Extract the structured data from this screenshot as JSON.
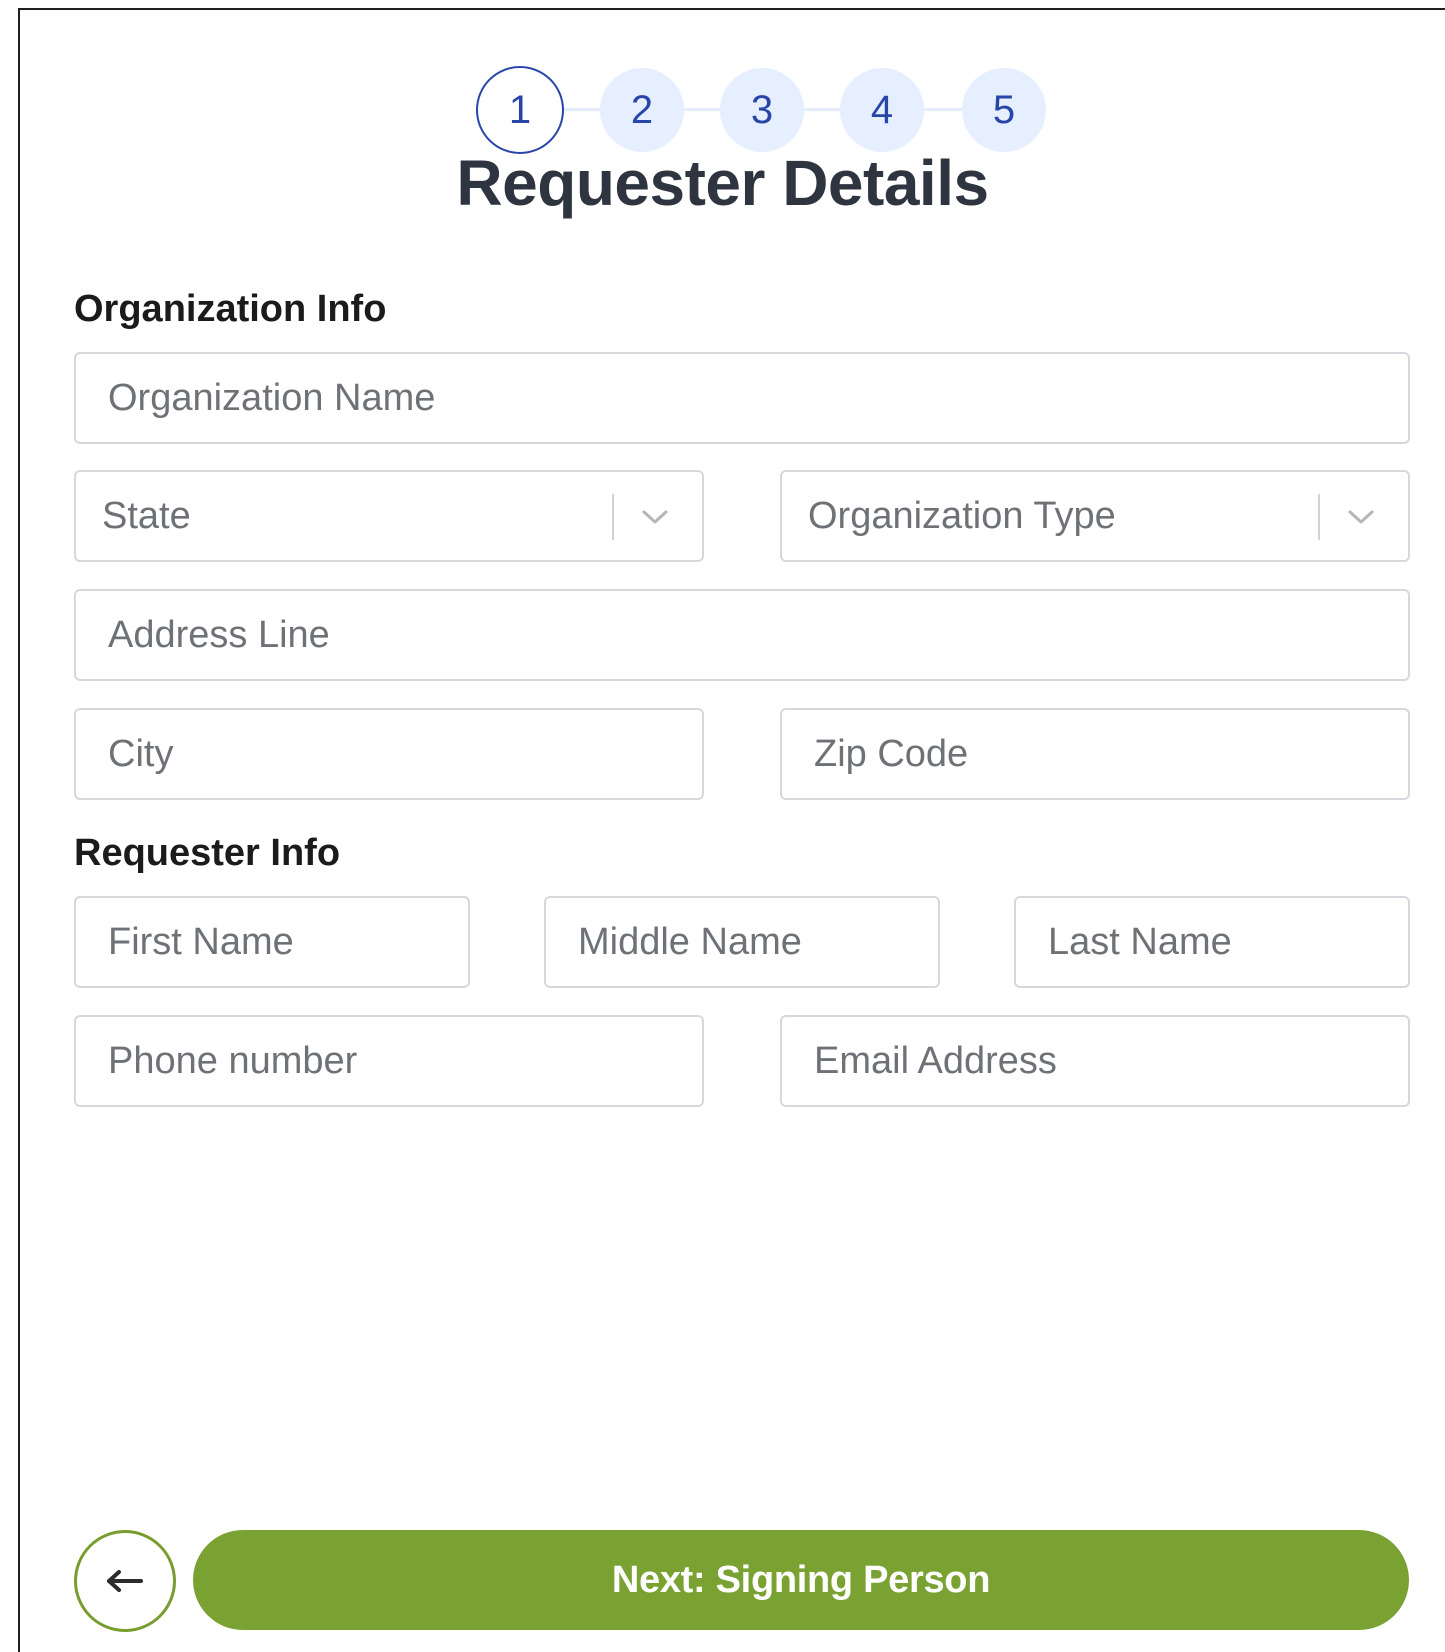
{
  "stepper": {
    "steps": [
      "1",
      "2",
      "3",
      "4",
      "5"
    ],
    "active_step": 1
  },
  "page_title": "Requester Details",
  "organization": {
    "section_title": "Organization Info",
    "name_placeholder": "Organization Name",
    "state_placeholder": "State",
    "type_placeholder": "Organization Type",
    "address_placeholder": "Address Line",
    "city_placeholder": "City",
    "zip_placeholder": "Zip Code"
  },
  "requester": {
    "section_title": "Requester Info",
    "first_name_placeholder": "First Name",
    "middle_name_placeholder": "Middle Name",
    "last_name_placeholder": "Last Name",
    "phone_placeholder": "Phone number",
    "email_placeholder": "Email Address"
  },
  "footer": {
    "back_icon": "arrow-left-icon",
    "next_label": "Next: Signing Person"
  },
  "colors": {
    "primary_green": "#7aa233",
    "step_blue": "#2746a8",
    "step_bg": "#e6efff"
  }
}
